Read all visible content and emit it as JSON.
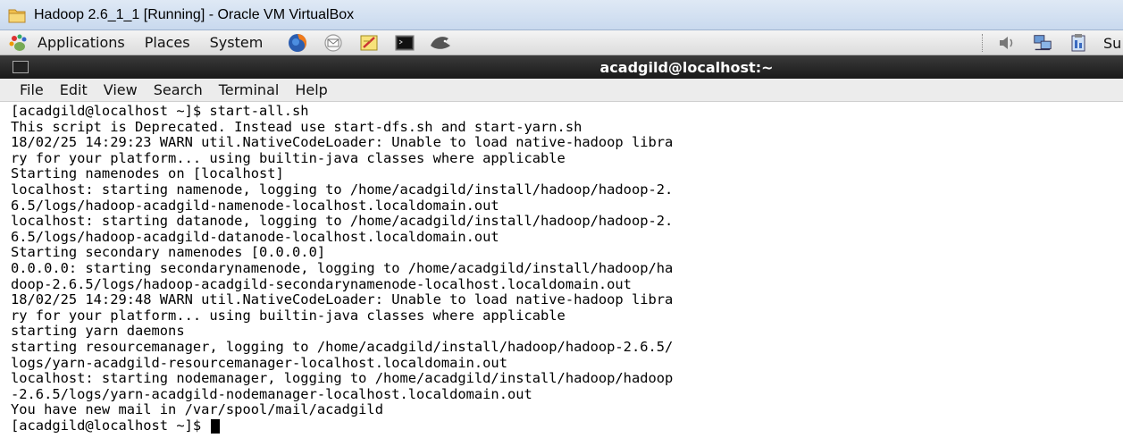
{
  "vbox": {
    "title": "Hadoop 2.6_1_1 [Running] - Oracle VM VirtualBox"
  },
  "panel": {
    "menus": [
      "Applications",
      "Places",
      "System"
    ],
    "launchers": [
      "firefox-icon",
      "mail-icon",
      "text-editor-icon",
      "terminal-icon",
      "fish-icon"
    ],
    "tray_icons": [
      "volume-icon",
      "network-icon",
      "clipboard-icon"
    ],
    "clock_partial": "Su"
  },
  "terminal": {
    "title": "acadgild@localhost:~",
    "menu": [
      "File",
      "Edit",
      "View",
      "Search",
      "Terminal",
      "Help"
    ],
    "lines": [
      "[acadgild@localhost ~]$ start-all.sh",
      "This script is Deprecated. Instead use start-dfs.sh and start-yarn.sh",
      "18/02/25 14:29:23 WARN util.NativeCodeLoader: Unable to load native-hadoop libra",
      "ry for your platform... using builtin-java classes where applicable",
      "Starting namenodes on [localhost]",
      "localhost: starting namenode, logging to /home/acadgild/install/hadoop/hadoop-2.",
      "6.5/logs/hadoop-acadgild-namenode-localhost.localdomain.out",
      "localhost: starting datanode, logging to /home/acadgild/install/hadoop/hadoop-2.",
      "6.5/logs/hadoop-acadgild-datanode-localhost.localdomain.out",
      "Starting secondary namenodes [0.0.0.0]",
      "0.0.0.0: starting secondarynamenode, logging to /home/acadgild/install/hadoop/ha",
      "doop-2.6.5/logs/hadoop-acadgild-secondarynamenode-localhost.localdomain.out",
      "18/02/25 14:29:48 WARN util.NativeCodeLoader: Unable to load native-hadoop libra",
      "ry for your platform... using builtin-java classes where applicable",
      "starting yarn daemons",
      "starting resourcemanager, logging to /home/acadgild/install/hadoop/hadoop-2.6.5/",
      "logs/yarn-acadgild-resourcemanager-localhost.localdomain.out",
      "localhost: starting nodemanager, logging to /home/acadgild/install/hadoop/hadoop",
      "-2.6.5/logs/yarn-acadgild-nodemanager-localhost.localdomain.out",
      "You have new mail in /var/spool/mail/acadgild"
    ],
    "prompt": "[acadgild@localhost ~]$ "
  }
}
